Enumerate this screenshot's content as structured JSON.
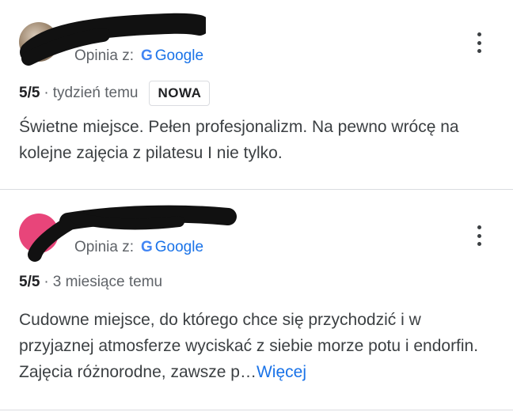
{
  "reviews": [
    {
      "source_prefix": "Opinia z:",
      "source_name": "Google",
      "rating": "5/5",
      "separator": "·",
      "time_ago": "tydzień temu",
      "badge": "NOWA",
      "text": "Świetne miejsce. Pełen profesjonalizm. Na pewno wrócę na kolejne zajęcia z pilatesu I nie tylko."
    },
    {
      "source_prefix": "Opinia z:",
      "source_name": "Google",
      "rating": "5/5",
      "separator": "·",
      "time_ago": "3 miesiące temu",
      "text": "Cudowne miejsce, do którego chce się przychodzić i w przyjaznej atmosferze wyciskać z siebie morze potu i endorfin. Zajęcia różnorodne, zawsze p…",
      "more_label": "Więcej"
    }
  ],
  "google_logo_letter": "G",
  "colors": {
    "link": "#1a73e8",
    "secondary_text": "#5f6368",
    "divider": "#dadce0",
    "avatar_pink": "#e8457a",
    "redaction": "#111111"
  },
  "icons": [
    "more-vert-icon",
    "google-g-icon"
  ]
}
